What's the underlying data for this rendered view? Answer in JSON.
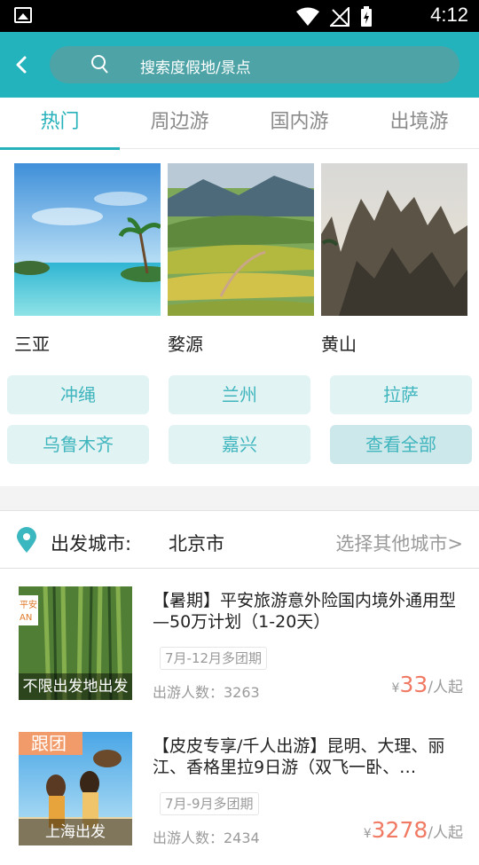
{
  "status_bar": {
    "time": "4:12"
  },
  "header": {
    "search_placeholder": "搜索度假地/景点"
  },
  "tabs": [
    {
      "label": "热门",
      "active": true
    },
    {
      "label": "周边游",
      "active": false
    },
    {
      "label": "国内游",
      "active": false
    },
    {
      "label": "出境游",
      "active": false
    }
  ],
  "featured": [
    {
      "name": "三亚"
    },
    {
      "name": "婺源"
    },
    {
      "name": "黄山"
    }
  ],
  "destinations": [
    "冲绳",
    "兰州",
    "拉萨",
    "乌鲁木齐",
    "嘉兴",
    "查看全部"
  ],
  "departure": {
    "label": "出发城市:",
    "city": "北京市",
    "choose_other": "选择其他城市>"
  },
  "products": [
    {
      "badge_corner": "平安\nAN",
      "thumb_band": "不限出发地出发",
      "title": "【暑期】平安旅游意外险国内境外通用型—50万计划（1-20天）",
      "schedule_tag": "7月-12月多团期",
      "travelers": "出游人数：3263",
      "currency": "¥",
      "price": "33",
      "price_unit": "/人起"
    },
    {
      "badge_corner": "跟团",
      "thumb_band": "上海出发",
      "title": "【皮皮专享/千人出游】昆明、大理、丽江、香格里拉9日游（双飞一卧、…",
      "schedule_tag": "7月-9月多团期",
      "travelers": "出游人数：2434",
      "currency": "¥",
      "price": "3278",
      "price_unit": "/人起"
    }
  ],
  "colors": {
    "accent": "#22b3bd",
    "price": "#f07a63",
    "chip_bg": "#e2f3f4"
  }
}
